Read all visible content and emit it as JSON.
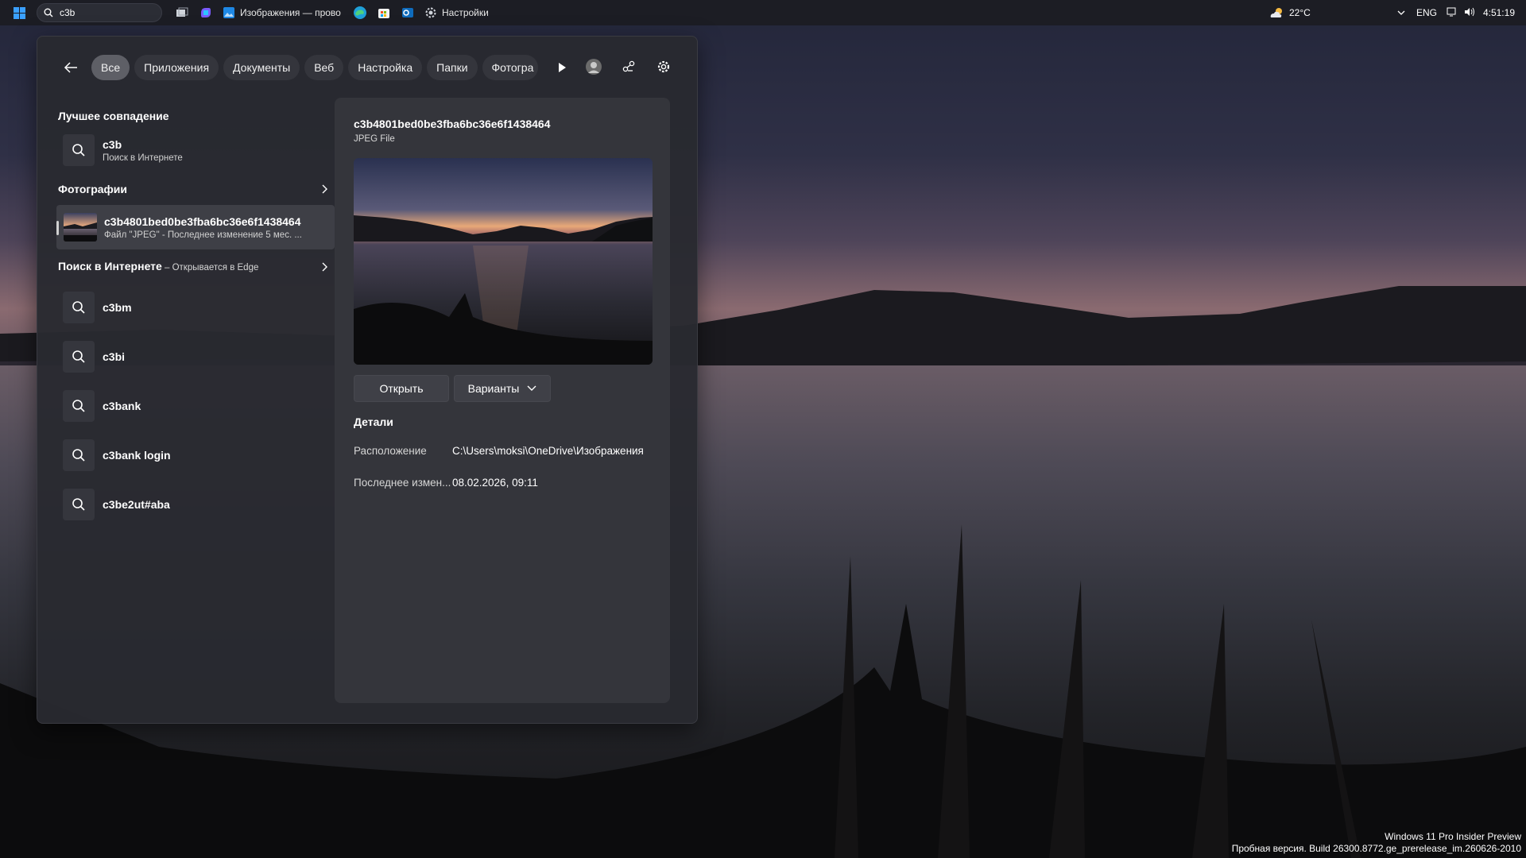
{
  "taskbar": {
    "search_value": "c3b",
    "apps": [
      {
        "icon": "task-view-icon",
        "label": ""
      },
      {
        "icon": "copilot-icon",
        "label": ""
      },
      {
        "icon": "photos-app-icon",
        "label": "Изображения — прово"
      },
      {
        "icon": "edge-icon",
        "label": ""
      },
      {
        "icon": "store-icon",
        "label": ""
      },
      {
        "icon": "outlook-icon",
        "label": ""
      },
      {
        "icon": "settings-gear-icon",
        "label": "Настройки"
      }
    ],
    "weather": "22°C",
    "language": "ENG",
    "time": "4:51:19"
  },
  "filters": {
    "items": [
      "Все",
      "Приложения",
      "Документы",
      "Веб",
      "Настройка",
      "Папки",
      "Фотогра"
    ],
    "active": "Все"
  },
  "left": {
    "best_match_title": "Лучшее совпадение",
    "best_match": {
      "title": "c3b",
      "subtitle": "Поиск в Интернете"
    },
    "photos_title": "Фотографии",
    "photo_result": {
      "title": "c3b4801bed0be3fba6bc36e6f1438464",
      "subtitle": "Файл \"JPEG\" - Последнее изменение 5 мес. ..."
    },
    "web_title": "Поиск в Интернете",
    "web_subtitle": " – Открывается в Edge",
    "web_results": [
      "c3bm",
      "c3bi",
      "c3bank",
      "c3bank login",
      "c3be2ut#aba"
    ]
  },
  "right": {
    "title": "c3b4801bed0be3fba6bc36e6f1438464",
    "subtitle": "JPEG File",
    "open_label": "Открыть",
    "options_label": "Варианты",
    "details_title": "Детали",
    "location_label": "Расположение",
    "location_value": "C:\\Users\\moksi\\OneDrive\\Изображения",
    "modified_label": "Последнее измен...",
    "modified_value": "08.02.2026, 09:11"
  },
  "watermark": {
    "line1": "Windows 11 Pro Insider Preview",
    "line2": "Пробная версия. Build 26300.8772.ge_prerelease_im.260626-2010"
  }
}
